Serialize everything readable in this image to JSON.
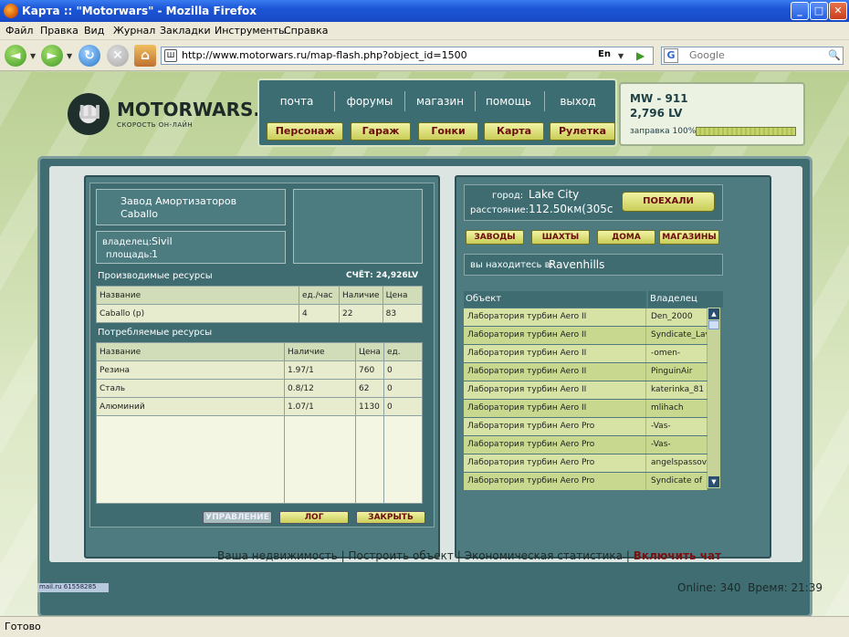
{
  "window": {
    "title": "Карта :: \"Motorwars\" - Mozilla Firefox",
    "minimize": "_",
    "maximize": "□",
    "close": "✕"
  },
  "menu": [
    "Файл",
    "Правка",
    "Вид",
    "Журнал",
    "Закладки",
    "Инструменты",
    "Справка"
  ],
  "nav": {
    "url": "http://www.motorwars.ru/map-flash.php?object_id=1500",
    "lang": "En",
    "google_placeholder": "Google",
    "icons": [
      "back-icon",
      "forward-icon",
      "reload-icon",
      "stop-icon",
      "home-icon",
      "search-icon"
    ]
  },
  "site": {
    "logo_name": "MOTORWARS.RU",
    "logo_sub": "СКОРОСТЬ ОН-ЛАЙН",
    "top_links": [
      "почта",
      "форумы",
      "магазин",
      "помощь",
      "выход"
    ],
    "top_buttons": [
      "Персонаж",
      "Гараж",
      "Гонки",
      "Карта",
      "Рулетка"
    ],
    "status": {
      "car": "MW - 911",
      "lv": "2,796 LV",
      "fuel_label": "заправка 100%",
      "fuel_level": 1.0
    }
  },
  "factory": {
    "name_line1": "Завод Амортизаторов",
    "name_line2": "Caballo",
    "owner_label": "владелец:",
    "owner": "Sivil",
    "area_label": "площадь:",
    "area": "1",
    "produced_title": "Производимые ресурсы",
    "account": "СЧЁТ: 24,926LV",
    "produced_headers": [
      "Название",
      "ед./час",
      "Наличие",
      "Цена"
    ],
    "produced_rows": [
      [
        "Caballo (p)",
        "4",
        "22",
        "83"
      ]
    ],
    "consumed_title": "Потребляемые ресурсы",
    "consumed_headers": [
      "Название",
      "Наличие",
      "Цена",
      "ед."
    ],
    "consumed_rows": [
      [
        "Резина",
        "1.97/1",
        "760",
        "0"
      ],
      [
        "Сталь",
        "0.8/12",
        "62",
        "0"
      ],
      [
        "Алюминий",
        "1.07/1",
        "1130",
        "0"
      ]
    ],
    "buttons": [
      "УПРАВЛЕНИЕ",
      "ЛОГ",
      "ЗАКРЫТЬ"
    ]
  },
  "travel": {
    "city_label": "город:",
    "city": "Lake City",
    "distance_label": "расстояние:",
    "distance": "112.50км(305с",
    "go_button": "ПОЕХАЛИ",
    "tabs": [
      "ЗАВОДЫ",
      "ШАХТЫ",
      "ДОМА",
      "МАГАЗИНЫ"
    ],
    "location_label": "вы находитесь в:",
    "location": "Ravenhills",
    "list_headers": [
      "Объект",
      "Владелец"
    ],
    "list_rows": [
      [
        "Лаборатория турбин Aero II",
        "Den_2000"
      ],
      [
        "Лаборатория турбин Aero II",
        "Syndicate_Lav"
      ],
      [
        "Лаборатория турбин Aero II",
        "-omen-"
      ],
      [
        "Лаборатория турбин Aero II",
        "PinguinAir"
      ],
      [
        "Лаборатория турбин Aero II",
        "katerinka_81"
      ],
      [
        "Лаборатория турбин Aero II",
        "mlihach"
      ],
      [
        "Лаборатория турбин Aero Pro",
        "-Vas-"
      ],
      [
        "Лаборатория турбин Aero Pro",
        "-Vas-"
      ],
      [
        "Лаборатория турбин Aero Pro",
        "angelspassov"
      ],
      [
        "Лаборатория турбин Aero Pro",
        "Syndicate of"
      ]
    ]
  },
  "footer": {
    "links": [
      "Ваша недвижимость",
      "Построить объект",
      "Экономическая статистика"
    ],
    "chat": "Включить чат",
    "mail_badge": "mail.ru 61558285",
    "online": "Online: 340",
    "time": "Время: 21:39"
  },
  "statusbar": "Готово"
}
